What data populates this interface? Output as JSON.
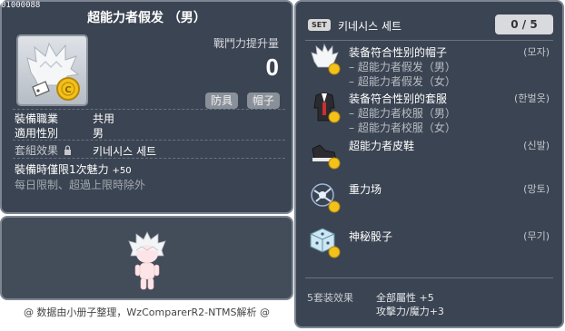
{
  "item_id": "01000088",
  "item": {
    "name": "超能力者假发 （男）",
    "stat_label": "戰鬥力提升量",
    "stat_value": "0",
    "tags": [
      "防具",
      "帽子"
    ],
    "job_label": "裝備職業",
    "job_value": "共用",
    "gender_label": "適用性別",
    "gender_value": "男",
    "set_label": "套組效果",
    "set_value": "키네시스 세트",
    "equip_bonus_text": "裝備時僅限1次魅力",
    "equip_bonus_value": "+50",
    "daily_note": "每日限制、超過上限時除外"
  },
  "credit": "@ 数据由小册子整理，WzComparerR2-NTMS解析 @",
  "set": {
    "badge": "SET",
    "name": "키네시스 세트",
    "count": "0 / 5",
    "items": [
      {
        "lines": [
          "装备符合性别的帽子",
          "– 超能力者假发（男）",
          "– 超能力者假发（女）"
        ],
        "type": "(모자)"
      },
      {
        "lines": [
          "装备符合性别的套服",
          "– 超能力者校服（男）",
          "– 超能力者校服（女）"
        ],
        "type": "(한벌옷)"
      },
      {
        "lines": [
          "超能力者皮鞋"
        ],
        "type": "(신발)"
      },
      {
        "lines": [
          "重力场"
        ],
        "type": "(망토)"
      },
      {
        "lines": [
          "神秘骰子"
        ],
        "type": "(무기)"
      }
    ],
    "bonus_label": "5套装效果",
    "bonus_lines": [
      "全部屬性 +5",
      "攻擊力/魔力+3"
    ]
  },
  "colors": {
    "panel_bg": "#3b4452",
    "panel_border": "#7c8591",
    "tag_bg": "#8a9099",
    "coin": "#f2c21b"
  }
}
